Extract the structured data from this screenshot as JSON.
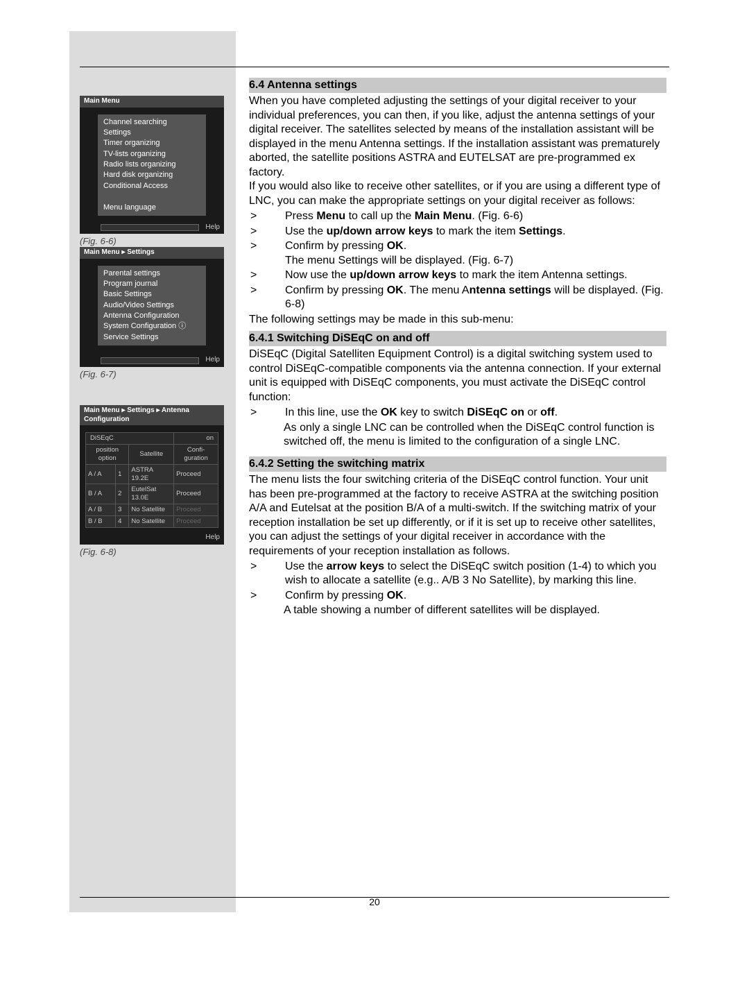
{
  "page_number": "20",
  "figures": {
    "fig66": {
      "caption": "(Fig. 6-6)",
      "breadcrumb": "Main Menu",
      "items": [
        "Channel searching",
        "Settings",
        "Timer organizing",
        "TV-lists organizing",
        "Radio lists organizing",
        "Hard disk organizing",
        "Conditional Access",
        "",
        "Menu language"
      ],
      "help": "Help"
    },
    "fig67": {
      "caption": "(Fig. 6-7)",
      "breadcrumb": "Main Menu ▸ Settings",
      "items": [
        "Parental settings",
        "Program journal",
        "Basic Settings",
        "Audio/Video Settings",
        "Antenna Configuration",
        "System Configuration ⓘ",
        "Service Settings"
      ],
      "help": "Help"
    },
    "fig68": {
      "caption": "(Fig. 6-8)",
      "breadcrumb": "Main Menu ▸ Settings ▸ Antenna Configuration",
      "diseqc_label": "DiSEqC",
      "diseqc_value": "on",
      "headers": {
        "pos": "position option",
        "sat": "Satellite",
        "conf": "Confi-\nguration"
      },
      "rows": [
        {
          "pos": "A / A",
          "n": "1",
          "sat": "ASTRA 19.2E",
          "proc": "Proceed",
          "dim": false
        },
        {
          "pos": "B / A",
          "n": "2",
          "sat": "EutelSat 13.0E",
          "proc": "Proceed",
          "dim": false
        },
        {
          "pos": "A / B",
          "n": "3",
          "sat": "No Satellite",
          "proc": "Proceed",
          "dim": true
        },
        {
          "pos": "B / B",
          "n": "4",
          "sat": "No Satellite",
          "proc": "Proceed",
          "dim": true
        }
      ],
      "help": "Help"
    }
  },
  "sections": {
    "h64": "6.4 Antenna settings",
    "p64": "When you have completed adjusting the settings of your digital receiver to your individual preferences, you can then, if you like, adjust the antenna settings of your digital receiver. The satellites selected by means of the installation assistant will be displayed in the menu Antenna settings. If the installation assistant was prematurely aborted, the satellite positions ASTRA and EUTELSAT are pre-programmed ex factory.\nIf you would also like to receive other satellites, or if you are using a different type of LNC, you can make the appropriate settings on your digital receiver as follows:",
    "steps64": [
      "Press <b>Menu</b> to call up the <b>Main Menu</b>. (Fig. 6-6)",
      "Use the <b>up/down arrow keys</b> to mark the item <b>Settings</b>.",
      "Confirm by pressing <b>OK</b>.<br>The menu Settings will be displayed. (Fig. 6-7)",
      "Now use the <b>up/down arrow keys</b> to mark the item Antenna settings.",
      "Confirm by pressing <b>OK</b>.  The menu  A<b>ntenna settings</b> will be displayed. (Fig. 6-8)"
    ],
    "p64_tail": "The following settings may be made in this sub-menu:",
    "h641": "6.4.1 Switching DiSEqC on and off",
    "p641": "DiSEqC (Digital Satelliten Equipment Control) is a digital switching system used to control DiSEqC-compatible components via the antenna connection. If your external unit is equipped with DiSEqC components, you must activate the DiSEqC control function:",
    "steps641": [
      "In this line, use the <b>OK</b> key to switch <b>DiSEqC on</b> or <b>off</b>."
    ],
    "p641_sub": "As only a single LNC can be controlled when the DiSEqC control function is switched off, the menu is limited to the configuration of a single LNC.",
    "h642": "6.4.2 Setting the switching matrix",
    "p642": "The menu lists the four switching criteria of the DiSEqC control function. Your unit has been pre-programmed at the factory to receive ASTRA at the switching position A/A and Eutelsat at the position B/A of a multi-switch. If the switching matrix of your reception installation be set up differently, or if it is set up to receive other satellites, you can adjust the settings of your digital receiver in accordance with the requirements of your reception installation as follows.",
    "steps642": [
      "Use the <b>arrow keys</b> to select the DiSEqC switch position (1-4) to which you wish to allocate a satellite (e.g.. A/B 3 No Satellite), by marking this line.",
      "Confirm by pressing <b>OK</b>."
    ],
    "p642_sub": "A table showing a number of different satellites will be displayed."
  }
}
